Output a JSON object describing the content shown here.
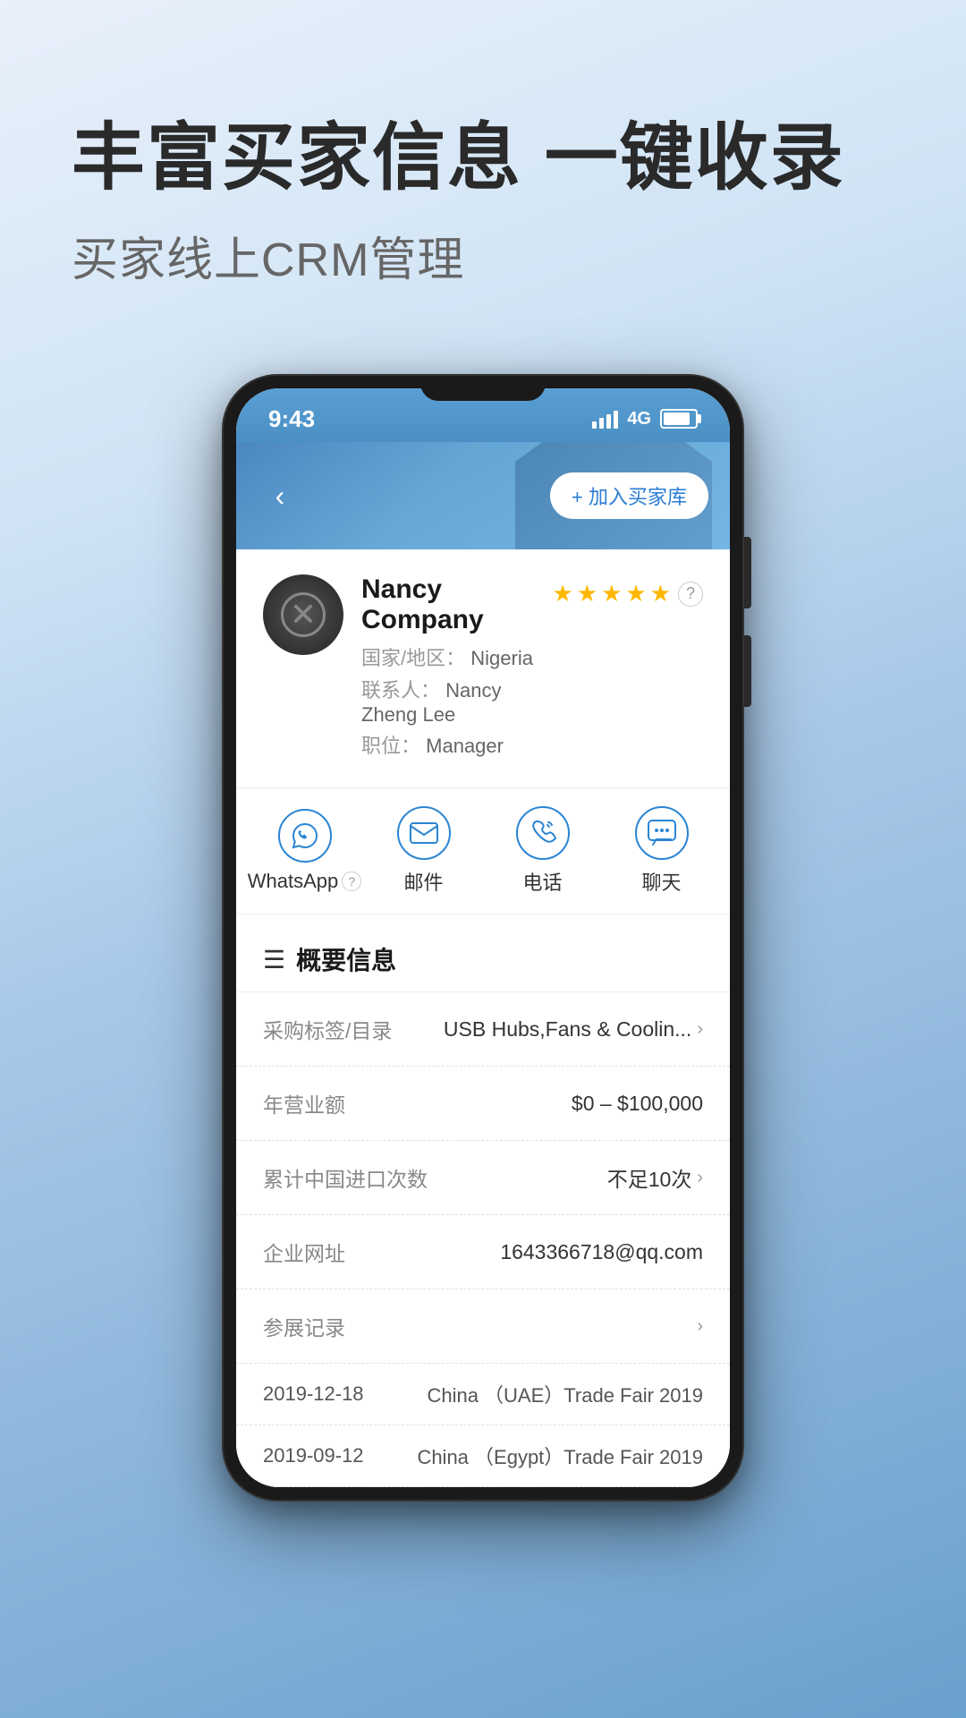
{
  "page": {
    "main_title": "丰富买家信息 一键收录",
    "sub_title": "买家线上CRM管理"
  },
  "phone": {
    "status_bar": {
      "time": "9:43",
      "signal": "4G"
    },
    "header": {
      "back_label": "‹",
      "add_buyer_label": "+ 加入买家库"
    },
    "company": {
      "name": "Nancy Company",
      "country_label": "国家/地区：",
      "country": "Nigeria",
      "contact_label": "联系人：",
      "contact": "Nancy Zheng Lee",
      "position_label": "职位：",
      "position": "Manager",
      "stars": 5
    },
    "actions": [
      {
        "id": "whatsapp",
        "label": "WhatsApp",
        "has_help": true,
        "icon": "whatsapp"
      },
      {
        "id": "email",
        "label": "邮件",
        "has_help": false,
        "icon": "email"
      },
      {
        "id": "phone",
        "label": "电话",
        "has_help": false,
        "icon": "phone"
      },
      {
        "id": "chat",
        "label": "聊天",
        "has_help": false,
        "icon": "chat"
      }
    ],
    "overview": {
      "section_title": "概要信息",
      "rows": [
        {
          "label": "采购标签/目录",
          "value": "USB Hubs,Fans & Coolin...",
          "has_chevron": true
        },
        {
          "label": "年营业额",
          "value": "$0 – $100,000",
          "has_chevron": false
        },
        {
          "label": "累计中国进口次数",
          "value": "不足10次",
          "has_chevron": true
        },
        {
          "label": "企业网址",
          "value": "1643366718@qq.com",
          "has_chevron": false
        },
        {
          "label": "参展记录",
          "value": "",
          "has_chevron": true
        }
      ],
      "expo_records": [
        {
          "date": "2019-12-18",
          "name": "China （UAE）Trade Fair 2019"
        },
        {
          "date": "2019-09-12",
          "name": "China （Egypt）Trade Fair 2019"
        }
      ]
    }
  }
}
